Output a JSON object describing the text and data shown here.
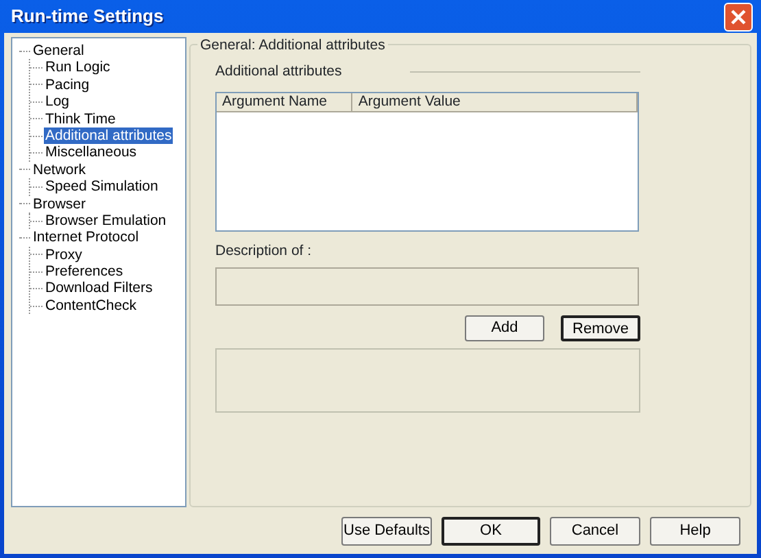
{
  "window": {
    "title": "Run-time Settings"
  },
  "tree": [
    {
      "label": "General",
      "selected": false,
      "children": [
        {
          "label": "Run Logic",
          "selected": false
        },
        {
          "label": "Pacing",
          "selected": false
        },
        {
          "label": "Log",
          "selected": false
        },
        {
          "label": "Think Time",
          "selected": false
        },
        {
          "label": "Additional attributes",
          "selected": true
        },
        {
          "label": "Miscellaneous",
          "selected": false
        }
      ]
    },
    {
      "label": "Network",
      "selected": false,
      "children": [
        {
          "label": "Speed Simulation",
          "selected": false
        }
      ]
    },
    {
      "label": "Browser",
      "selected": false,
      "children": [
        {
          "label": "Browser Emulation",
          "selected": false
        }
      ]
    },
    {
      "label": "Internet Protocol",
      "selected": false,
      "children": [
        {
          "label": "Proxy",
          "selected": false
        },
        {
          "label": "Preferences",
          "selected": false
        },
        {
          "label": "Download Filters",
          "selected": false
        },
        {
          "label": "ContentCheck",
          "selected": false
        }
      ]
    }
  ],
  "panel": {
    "title": "General: Additional attributes",
    "section": "Additional attributes",
    "table": {
      "columns": [
        "Argument Name",
        "Argument Value"
      ]
    },
    "description_label": "Description of :",
    "buttons": [
      {
        "label": "Add",
        "focused": false
      },
      {
        "label": "Remove",
        "focused": true
      }
    ]
  },
  "footer_buttons": [
    {
      "label": "Use Defaults",
      "focused": false
    },
    {
      "label": "OK",
      "focused": true
    },
    {
      "label": "Cancel",
      "focused": false
    },
    {
      "label": "Help",
      "focused": false
    }
  ]
}
